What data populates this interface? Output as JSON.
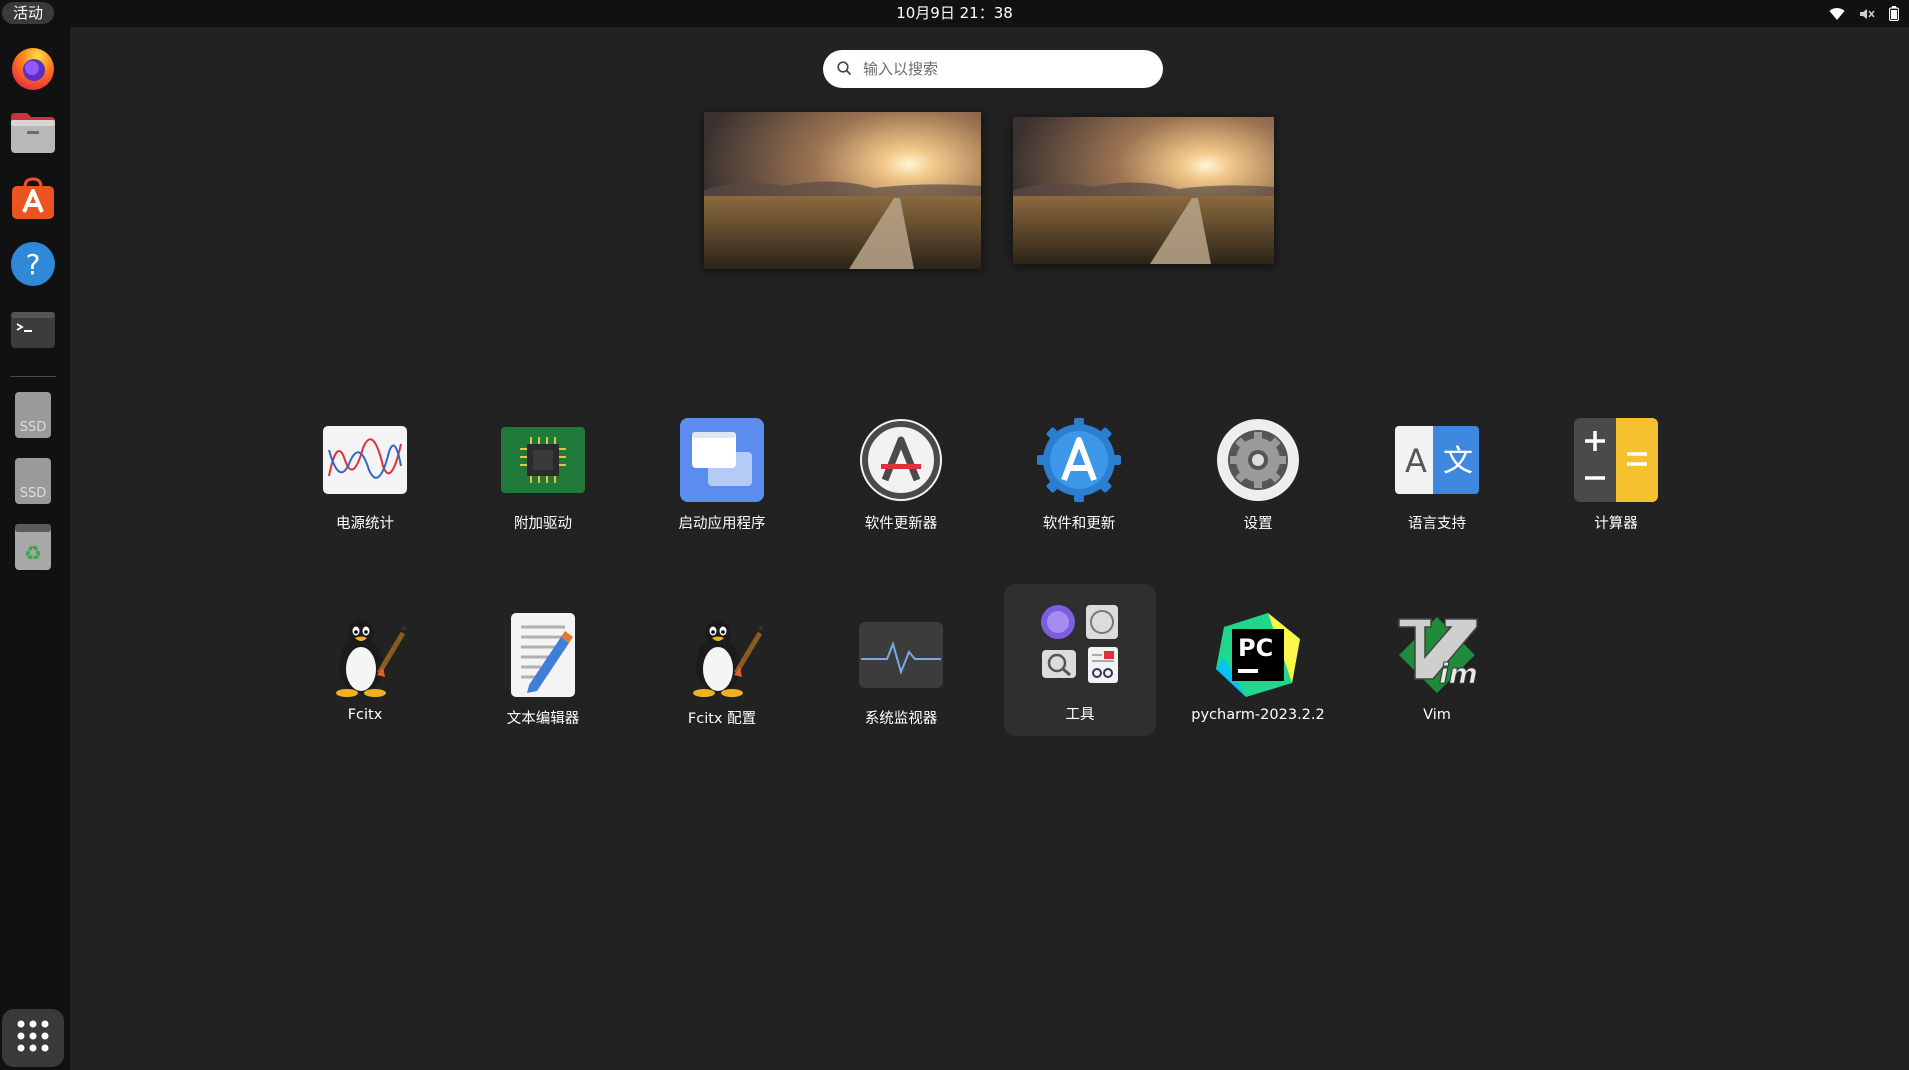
{
  "topbar": {
    "activities_label": "活动",
    "clock": "10月9日  21：38",
    "icons": [
      "wifi-icon",
      "volume-muted-icon",
      "battery-icon"
    ]
  },
  "dock": {
    "items": [
      {
        "name": "firefox",
        "icon": "firefox-icon"
      },
      {
        "name": "files",
        "icon": "files-icon"
      },
      {
        "name": "software",
        "icon": "app-store-icon"
      },
      {
        "name": "help",
        "icon": "help-icon"
      },
      {
        "name": "terminal",
        "icon": "terminal-icon"
      },
      {
        "name": "ssd-drive-1",
        "icon": "ssd-drive-icon",
        "label": "SSD"
      },
      {
        "name": "ssd-drive-2",
        "icon": "ssd-drive-icon",
        "label": "SSD"
      },
      {
        "name": "trash",
        "icon": "trash-icon"
      }
    ],
    "show_apps_icon": "grid-icon"
  },
  "search": {
    "placeholder": "输入以搜索"
  },
  "apps": {
    "row1": [
      {
        "label": "电源统计",
        "icon": "power-statistics-icon"
      },
      {
        "label": "附加驱动",
        "icon": "additional-drivers-icon"
      },
      {
        "label": "启动应用程序",
        "icon": "startup-applications-icon"
      },
      {
        "label": "软件更新器",
        "icon": "software-updater-icon"
      },
      {
        "label": "软件和更新",
        "icon": "software-properties-icon"
      },
      {
        "label": "设置",
        "icon": "settings-icon"
      },
      {
        "label": "语言支持",
        "icon": "language-support-icon",
        "glyphs": [
          "A",
          "文"
        ]
      },
      {
        "label": "计算器",
        "icon": "calculator-icon"
      }
    ],
    "row2": [
      {
        "label": "Fcitx",
        "icon": "fcitx-penguin-icon"
      },
      {
        "label": "文本编辑器",
        "icon": "text-editor-icon"
      },
      {
        "label": "Fcitx 配置",
        "icon": "fcitx-config-penguin-icon"
      },
      {
        "label": "系统监视器",
        "icon": "system-monitor-icon"
      },
      {
        "label": "工具",
        "icon": "utilities-folder-icon"
      },
      {
        "label": "pycharm-2023.2.2",
        "icon": "pycharm-icon",
        "glyph": "PC"
      },
      {
        "label": "Vim",
        "icon": "vim-icon"
      }
    ]
  }
}
